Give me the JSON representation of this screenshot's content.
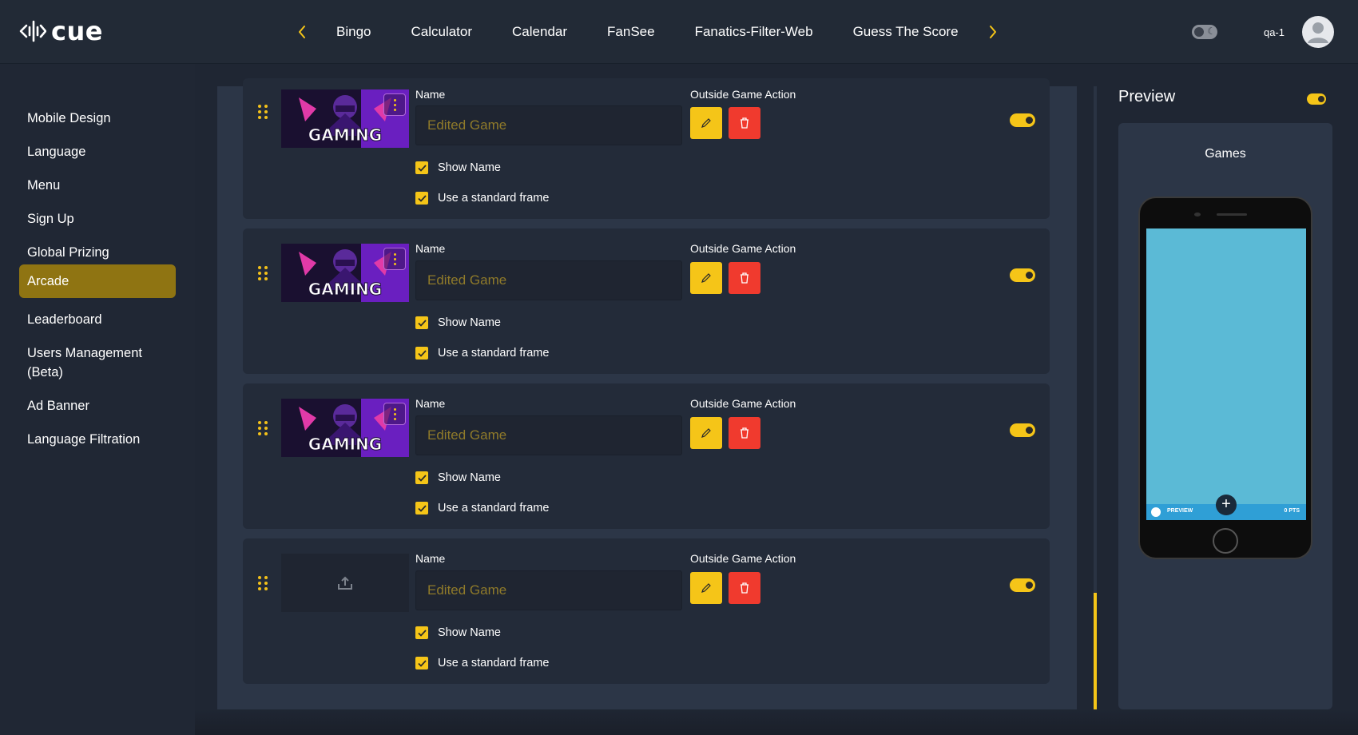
{
  "header": {
    "logo_text": "cue",
    "nav_tabs": [
      "Bingo",
      "Calculator",
      "Calendar",
      "FanSee",
      "Fanatics-Filter-Web",
      "Guess The Score"
    ],
    "username": "qa-1",
    "accent_color": "#f5c518"
  },
  "sidebar": {
    "items": [
      {
        "label": "Mobile Design"
      },
      {
        "label": "Language"
      },
      {
        "label": "Menu"
      },
      {
        "label": "Sign Up"
      },
      {
        "label": "Global Prizing"
      },
      {
        "label": "Arcade",
        "active": true
      },
      {
        "label": "Leaderboard"
      },
      {
        "label": "Users Management (Beta)"
      },
      {
        "label": "Ad Banner"
      },
      {
        "label": "Language Filtration"
      }
    ]
  },
  "games": [
    {
      "name_label": "Name",
      "action_label": "Outside Game Action",
      "name_placeholder": "Edited Game",
      "show_name_label": "Show Name",
      "show_name": true,
      "frame_label": "Use a standard frame",
      "frame": true,
      "thumb_text": "GAMING",
      "enabled": true
    },
    {
      "name_label": "Name",
      "action_label": "Outside Game Action",
      "name_placeholder": "Edited Game",
      "show_name_label": "Show Name",
      "show_name": true,
      "frame_label": "Use a standard frame",
      "frame": true,
      "thumb_text": "GAMING",
      "enabled": true
    },
    {
      "name_label": "Name",
      "action_label": "Outside Game Action",
      "name_placeholder": "Edited Game",
      "show_name_label": "Show Name",
      "show_name": true,
      "frame_label": "Use a standard frame",
      "frame": true,
      "thumb_text": "GAMING",
      "enabled": true
    },
    {
      "name_label": "Name",
      "action_label": "Outside Game Action",
      "name_placeholder": "Edited Game",
      "show_name_label": "Show Name",
      "show_name": true,
      "frame_label": "Use a standard frame",
      "frame": true,
      "thumb_text": "",
      "enabled": true
    }
  ],
  "preview": {
    "title": "Preview",
    "section_title": "Games",
    "bar_left": "PREVIEW",
    "bar_right": "0 PTS",
    "plus": "+"
  }
}
